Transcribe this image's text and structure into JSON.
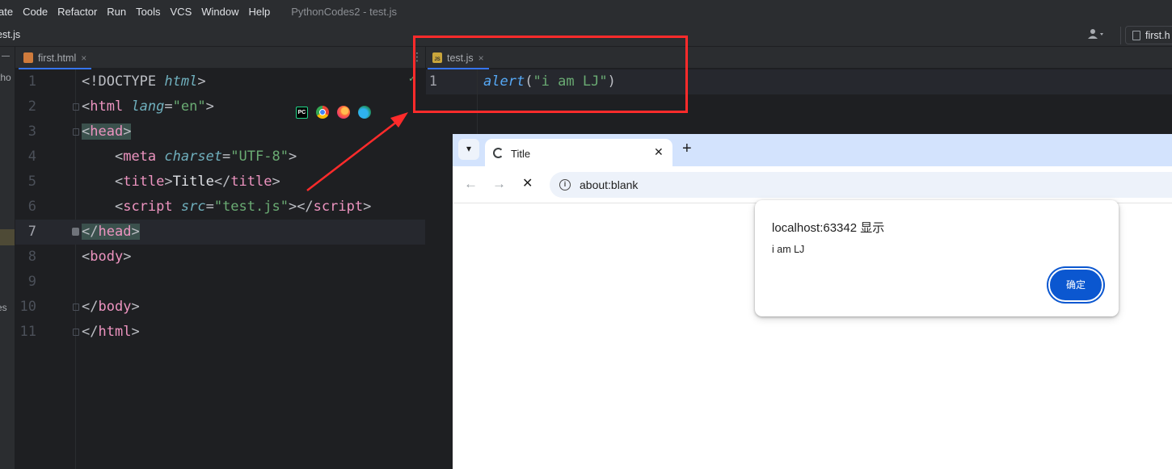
{
  "ide": {
    "menu": [
      "ate",
      "Code",
      "Refactor",
      "Run",
      "Tools",
      "VCS",
      "Window",
      "Help"
    ],
    "window_title": "PythonCodes2 - test.js",
    "nav_file": "est.js",
    "run_config": "first.h",
    "left_strip": {
      "text1": "tho",
      "text2": "es"
    },
    "tabs_left": [
      {
        "label": "first.html",
        "close": "×"
      }
    ],
    "tabs_right": [
      {
        "label": "test.js",
        "close": "×"
      }
    ],
    "editor_left": {
      "line_numbers": [
        "1",
        "2",
        "3",
        "4",
        "5",
        "6",
        "7",
        "8",
        "9",
        "10",
        "11"
      ],
      "current_line": "7"
    },
    "editor_right": {
      "line_numbers": [
        "1"
      ],
      "code": {
        "fn": "alert",
        "open": "(",
        "str": "\"i am LJ\"",
        "close": ")"
      }
    }
  },
  "browser": {
    "tab_title": "Title",
    "tab_close": "✕",
    "new_tab": "+",
    "url": "about:blank",
    "dialog": {
      "title": "localhost:63342 显示",
      "message": "i am LJ",
      "ok_label": "确定"
    }
  },
  "colors": {
    "annotation_red": "#ff2b2b",
    "ok_button": "#0b57d0",
    "tab_strip": "#d3e3fd"
  }
}
